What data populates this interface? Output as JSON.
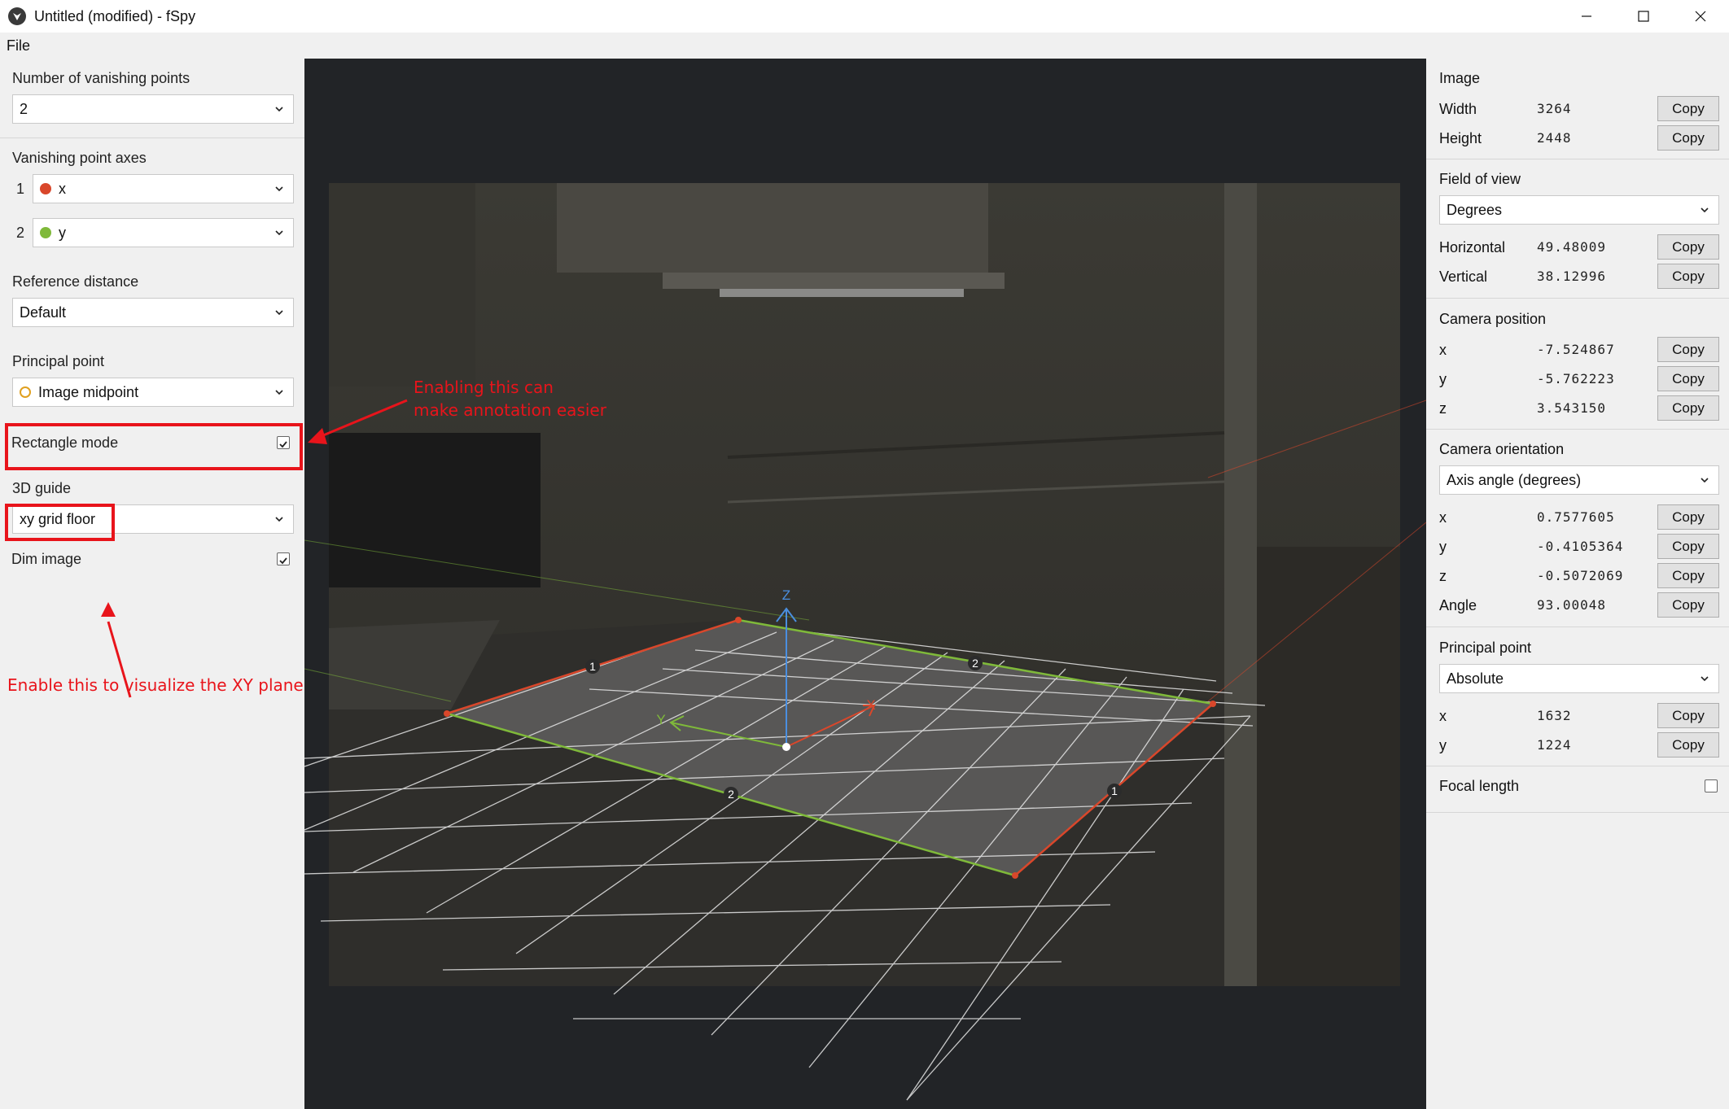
{
  "window": {
    "title": "Untitled (modified) - fSpy"
  },
  "menu": {
    "file": "File"
  },
  "left": {
    "num_vp_label": "Number of vanishing points",
    "num_vp_value": "2",
    "vp_axes_label": "Vanishing point axes",
    "axis1_index": "1",
    "axis1_value": "x",
    "axis2_index": "2",
    "axis2_value": "y",
    "ref_distance_label": "Reference distance",
    "ref_distance_value": "Default",
    "principal_point_label": "Principal point",
    "principal_point_value": "Image midpoint",
    "rect_mode_label": "Rectangle mode",
    "guide_label": "3D guide",
    "guide_value": "xy grid floor",
    "dim_image_label": "Dim image"
  },
  "annotations": {
    "rect_note_line1": "Enabling this can",
    "rect_note_line2": "make annotation easier",
    "grid_note": "Enable this to visualize the XY plane"
  },
  "viewport": {
    "axis_z": "Z",
    "axis_y": "Y",
    "axis_x": "X",
    "handle_1a": "1",
    "handle_1b": "1",
    "handle_2a": "2",
    "handle_2b": "2"
  },
  "right": {
    "image_title": "Image",
    "width_label": "Width",
    "width_value": "3264",
    "height_label": "Height",
    "height_value": "2448",
    "fov_title": "Field of view",
    "fov_unit": "Degrees",
    "horizontal_label": "Horizontal",
    "horizontal_value": "49.48009",
    "vertical_label": "Vertical",
    "vertical_value": "38.12996",
    "cam_pos_title": "Camera position",
    "pos_x_label": "x",
    "pos_x_value": "-7.524867",
    "pos_y_label": "y",
    "pos_y_value": "-5.762223",
    "pos_z_label": "z",
    "pos_z_value": "3.543150",
    "cam_orient_title": "Camera orientation",
    "orient_mode": "Axis angle (degrees)",
    "or_x_label": "x",
    "or_x_value": "0.7577605",
    "or_y_label": "y",
    "or_y_value": "-0.4105364",
    "or_z_label": "z",
    "or_z_value": "-0.5072069",
    "angle_label": "Angle",
    "angle_value": "93.00048",
    "pp_title": "Principal point",
    "pp_mode": "Absolute",
    "pp_x_label": "x",
    "pp_x_value": "1632",
    "pp_y_label": "y",
    "pp_y_value": "1224",
    "focal_label": "Focal length",
    "copy_label": "Copy"
  },
  "colors": {
    "x_axis": "#d9472b",
    "y_axis": "#7fb93a",
    "z_axis": "#4a8fe0",
    "annotation": "#e8141b",
    "principal_point": "#e0a020"
  }
}
